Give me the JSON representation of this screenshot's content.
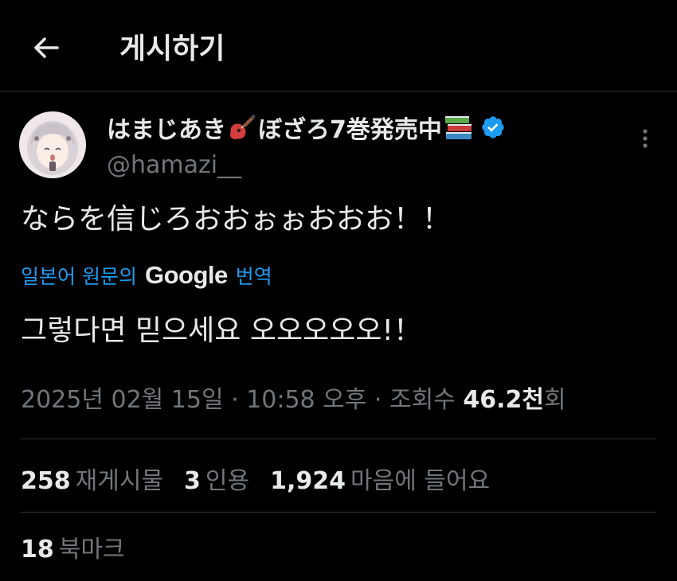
{
  "header": {
    "title": "게시하기"
  },
  "post": {
    "author": {
      "display_name_prefix": "はまじあき",
      "display_name_suffix": "ぼざろ7巻発売中",
      "handle": "@hamazi__",
      "verified": true
    },
    "text": "ならを信じろおおぉぉおおお！！",
    "translation": {
      "link_prefix": "일본어 원문의",
      "provider": "Google",
      "link_suffix": "번역",
      "text": "그렇다면 믿으세요 오오오오오!！"
    },
    "meta": {
      "date": "2025년 02월 15일",
      "separator": " · ",
      "time": "10:58 오후",
      "views_label": "조회수",
      "views_count": "46.2천",
      "views_suffix": "회"
    },
    "stats": {
      "reposts_count": "258",
      "reposts_label": "재게시물",
      "quotes_count": "3",
      "quotes_label": "인용",
      "likes_count": "1,924",
      "likes_label": "마음에 들어요",
      "bookmarks_count": "18",
      "bookmarks_label": "북마크"
    }
  },
  "colors": {
    "background": "#000000",
    "text_primary": "#e7e9ea",
    "text_secondary": "#71767b",
    "link": "#1d9bf0",
    "divider": "#2f3336",
    "verified_badge": "#1d9bf0"
  },
  "icons": {
    "back": "arrow-left-icon",
    "more": "more-vertical-icon",
    "guitar_emoji": "guitar-icon",
    "books_emoji": "books-icon",
    "verified": "verified-badge-icon"
  }
}
